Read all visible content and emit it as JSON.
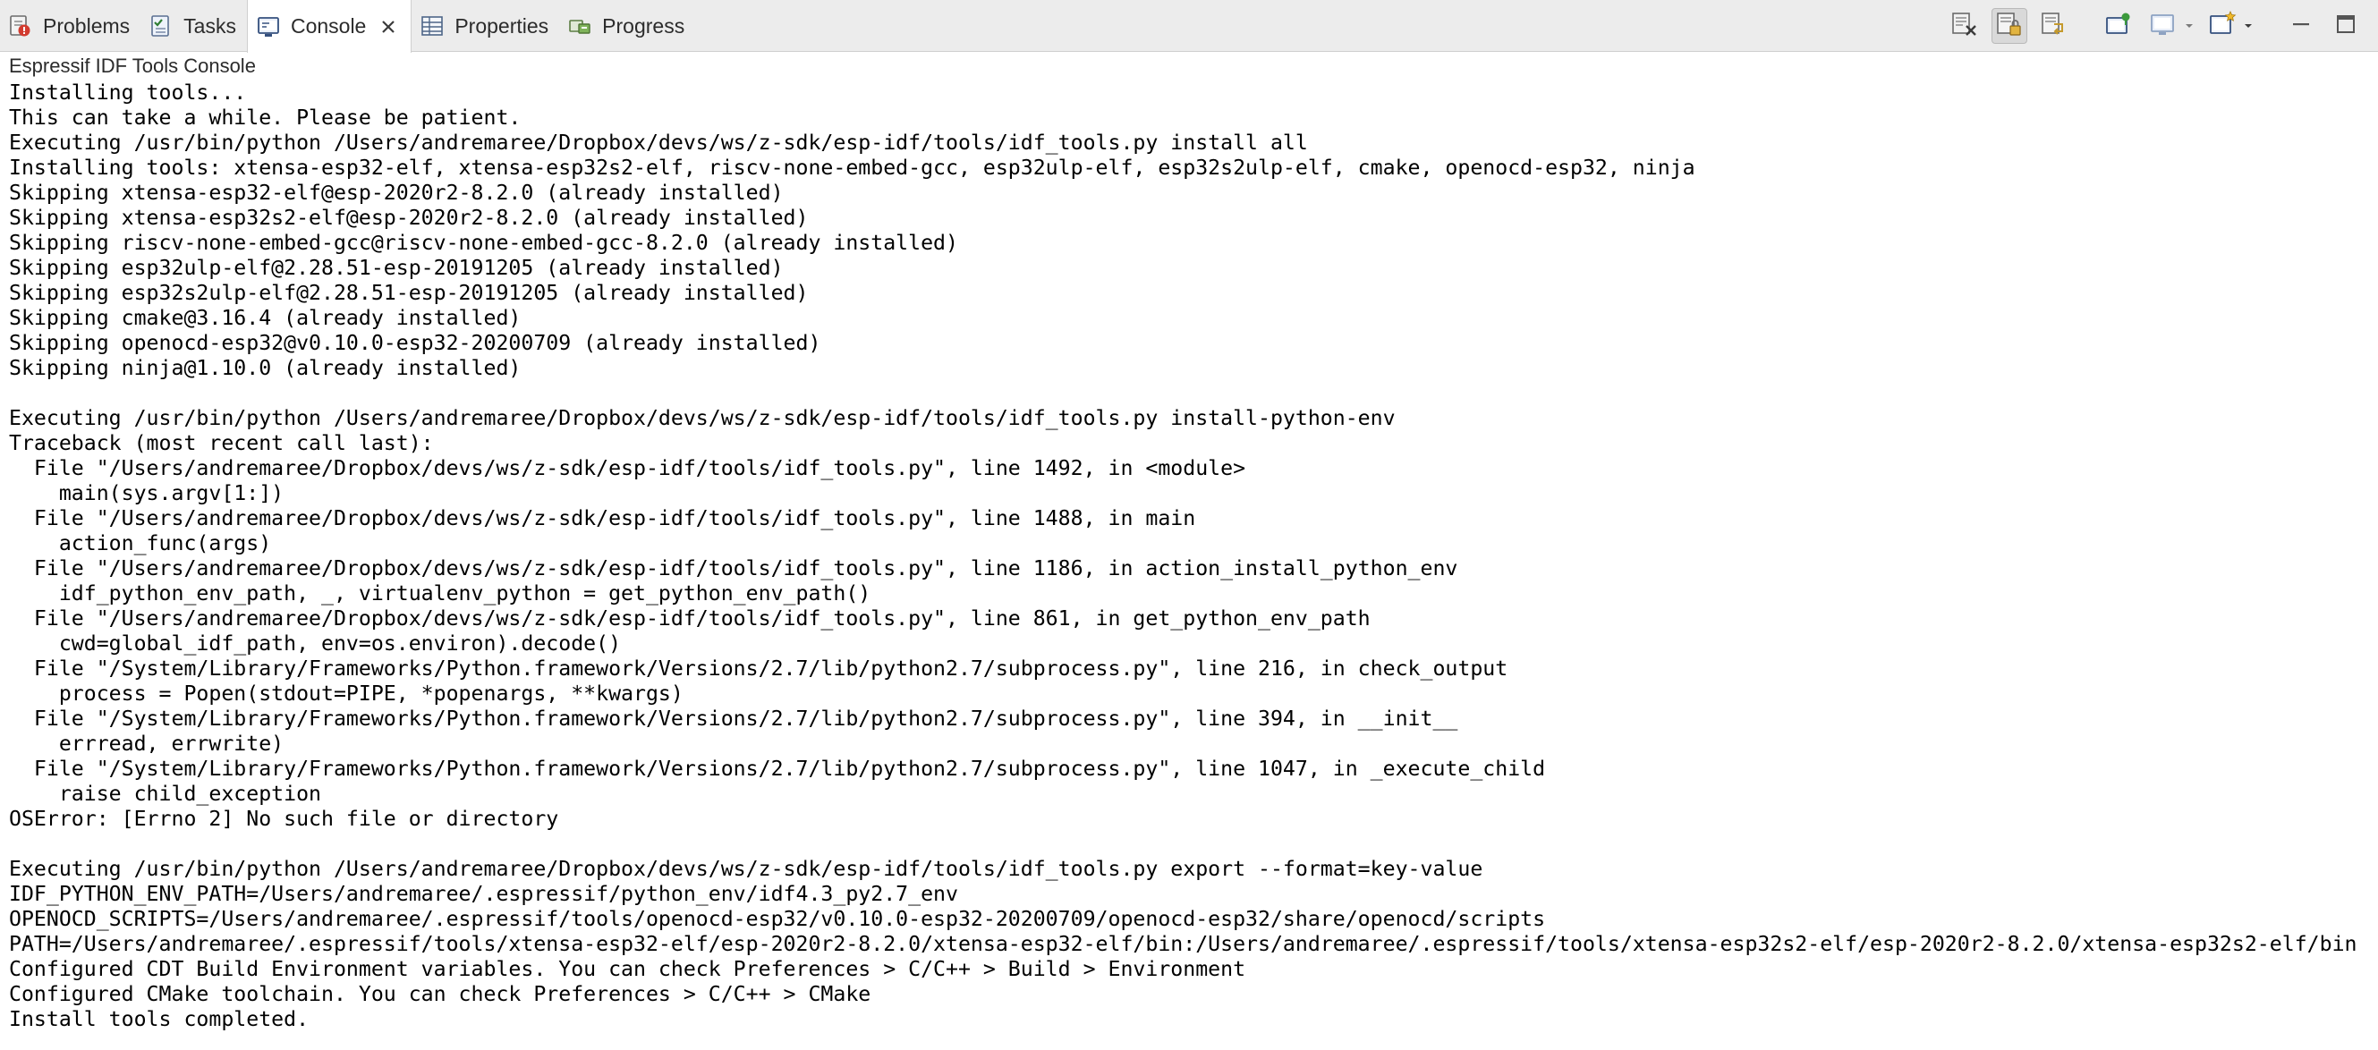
{
  "tabs": [
    {
      "label": "Problems",
      "icon": "problems-icon",
      "active": false
    },
    {
      "label": "Tasks",
      "icon": "tasks-icon",
      "active": false
    },
    {
      "label": "Console",
      "icon": "console-icon",
      "active": true
    },
    {
      "label": "Properties",
      "icon": "properties-icon",
      "active": false
    },
    {
      "label": "Progress",
      "icon": "progress-icon",
      "active": false
    }
  ],
  "toolbar": {
    "buttons": [
      "clear-console-icon",
      "scroll-lock-icon",
      "word-wrap-icon",
      "pin-console-icon",
      "display-console-icon",
      "open-console-icon",
      "view-menu-icon",
      "minimize-icon",
      "maximize-icon"
    ]
  },
  "console": {
    "title": "Espressif IDF Tools Console",
    "lines": [
      "Installing tools...",
      "This can take a while. Please be patient.",
      "Executing /usr/bin/python /Users/andremaree/Dropbox/devs/ws/z-sdk/esp-idf/tools/idf_tools.py install all",
      "Installing tools: xtensa-esp32-elf, xtensa-esp32s2-elf, riscv-none-embed-gcc, esp32ulp-elf, esp32s2ulp-elf, cmake, openocd-esp32, ninja",
      "Skipping xtensa-esp32-elf@esp-2020r2-8.2.0 (already installed)",
      "Skipping xtensa-esp32s2-elf@esp-2020r2-8.2.0 (already installed)",
      "Skipping riscv-none-embed-gcc@riscv-none-embed-gcc-8.2.0 (already installed)",
      "Skipping esp32ulp-elf@2.28.51-esp-20191205 (already installed)",
      "Skipping esp32s2ulp-elf@2.28.51-esp-20191205 (already installed)",
      "Skipping cmake@3.16.4 (already installed)",
      "Skipping openocd-esp32@v0.10.0-esp32-20200709 (already installed)",
      "Skipping ninja@1.10.0 (already installed)",
      "",
      "Executing /usr/bin/python /Users/andremaree/Dropbox/devs/ws/z-sdk/esp-idf/tools/idf_tools.py install-python-env",
      "Traceback (most recent call last):",
      "  File \"/Users/andremaree/Dropbox/devs/ws/z-sdk/esp-idf/tools/idf_tools.py\", line 1492, in <module>",
      "    main(sys.argv[1:])",
      "  File \"/Users/andremaree/Dropbox/devs/ws/z-sdk/esp-idf/tools/idf_tools.py\", line 1488, in main",
      "    action_func(args)",
      "  File \"/Users/andremaree/Dropbox/devs/ws/z-sdk/esp-idf/tools/idf_tools.py\", line 1186, in action_install_python_env",
      "    idf_python_env_path, _, virtualenv_python = get_python_env_path()",
      "  File \"/Users/andremaree/Dropbox/devs/ws/z-sdk/esp-idf/tools/idf_tools.py\", line 861, in get_python_env_path",
      "    cwd=global_idf_path, env=os.environ).decode()",
      "  File \"/System/Library/Frameworks/Python.framework/Versions/2.7/lib/python2.7/subprocess.py\", line 216, in check_output",
      "    process = Popen(stdout=PIPE, *popenargs, **kwargs)",
      "  File \"/System/Library/Frameworks/Python.framework/Versions/2.7/lib/python2.7/subprocess.py\", line 394, in __init__",
      "    errread, errwrite)",
      "  File \"/System/Library/Frameworks/Python.framework/Versions/2.7/lib/python2.7/subprocess.py\", line 1047, in _execute_child",
      "    raise child_exception",
      "OSError: [Errno 2] No such file or directory",
      "",
      "Executing /usr/bin/python /Users/andremaree/Dropbox/devs/ws/z-sdk/esp-idf/tools/idf_tools.py export --format=key-value",
      "IDF_PYTHON_ENV_PATH=/Users/andremaree/.espressif/python_env/idf4.3_py2.7_env",
      "OPENOCD_SCRIPTS=/Users/andremaree/.espressif/tools/openocd-esp32/v0.10.0-esp32-20200709/openocd-esp32/share/openocd/scripts",
      "PATH=/Users/andremaree/.espressif/tools/xtensa-esp32-elf/esp-2020r2-8.2.0/xtensa-esp32-elf/bin:/Users/andremaree/.espressif/tools/xtensa-esp32s2-elf/esp-2020r2-8.2.0/xtensa-esp32s2-elf/bin",
      "Configured CDT Build Environment variables. You can check Preferences > C/C++ > Build > Environment",
      "Configured CMake toolchain. You can check Preferences > C/C++ > CMake",
      "Install tools completed."
    ]
  }
}
